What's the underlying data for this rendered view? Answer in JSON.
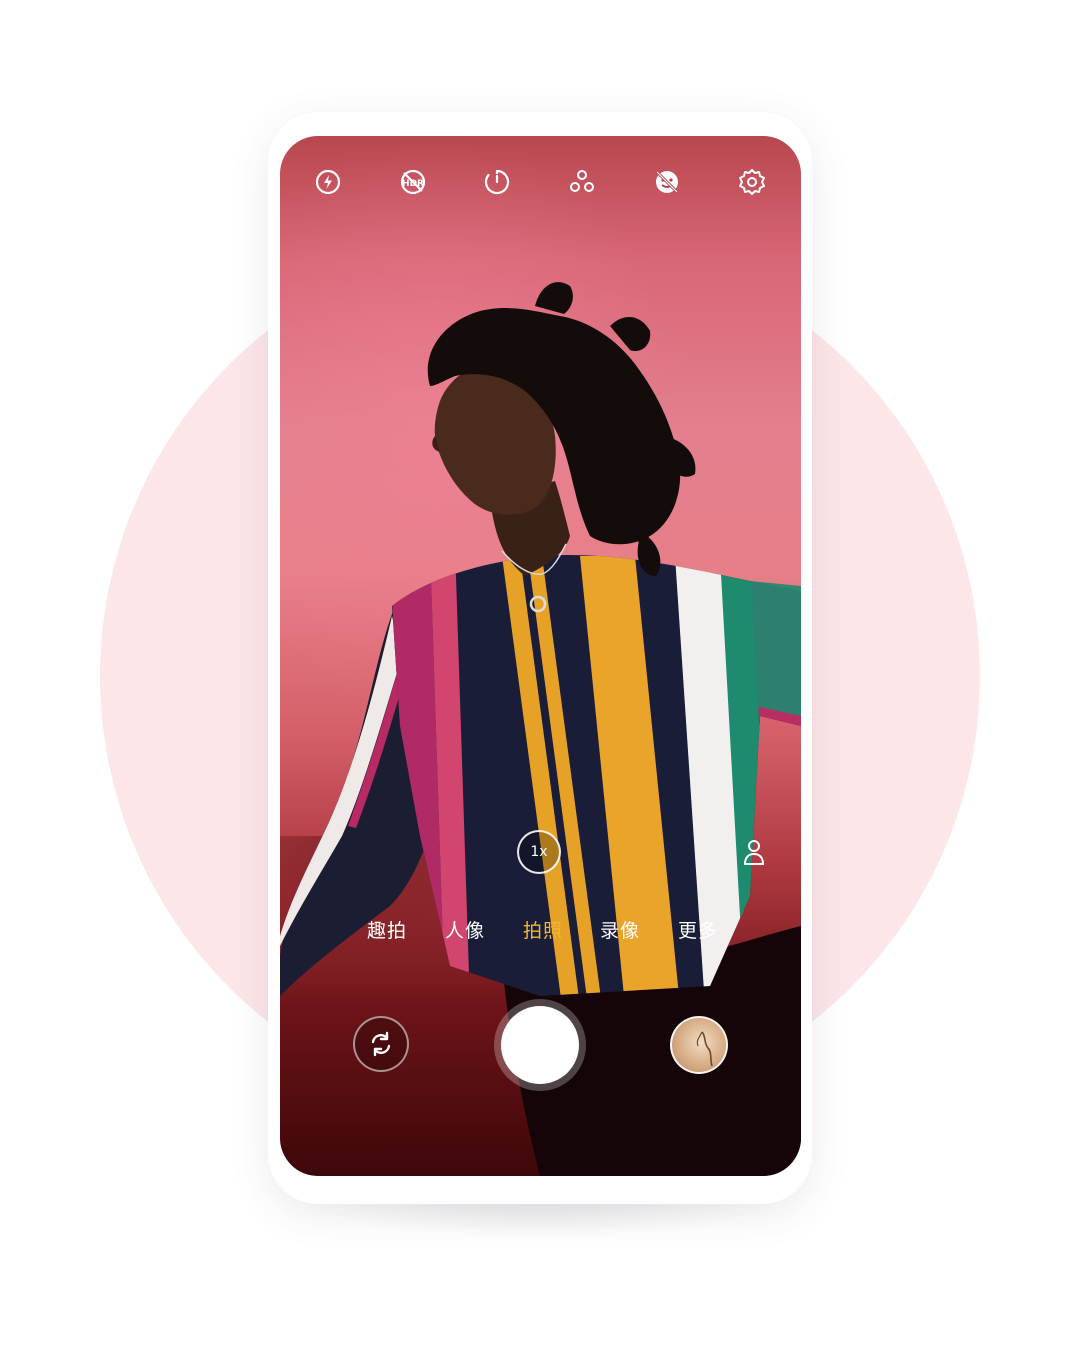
{
  "toolbar": {
    "icons": [
      "flash-auto-icon",
      "hdr-off-icon",
      "timer-icon",
      "filter-icon",
      "beauty-off-icon",
      "settings-icon"
    ],
    "hdr_text": "HDR"
  },
  "zoom": {
    "label": "1x"
  },
  "modes": {
    "items": [
      {
        "label": "趣拍"
      },
      {
        "label": "人像"
      },
      {
        "label": "拍照"
      },
      {
        "label": "录像"
      },
      {
        "label": "更多"
      }
    ],
    "active_index": 2
  },
  "colors": {
    "accent": "#f4b533",
    "background_circle": "#fde6e8",
    "wall": "#e37f8e"
  }
}
